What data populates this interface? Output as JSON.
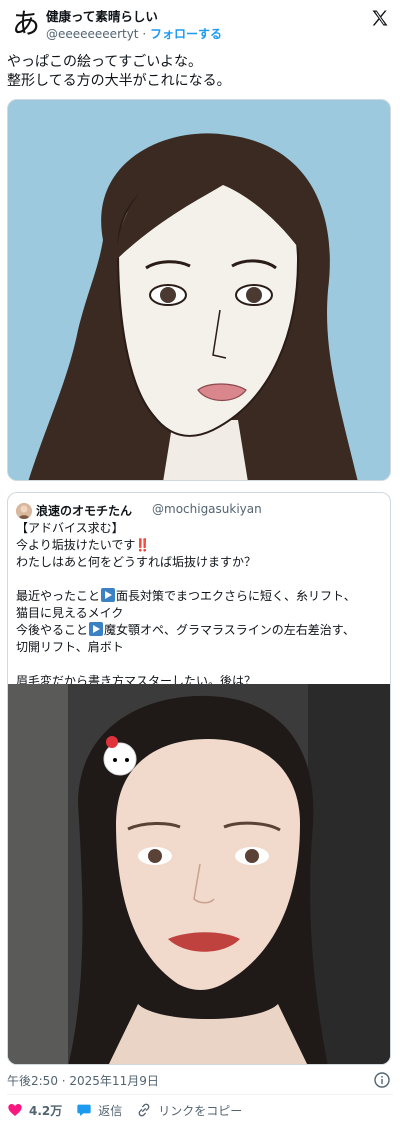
{
  "author": {
    "avatar_char": "あ",
    "name": "健康って素晴らしい",
    "handle": "@eeeeeeeertyt",
    "separator": "·",
    "follow_label": "フォローする"
  },
  "tweet": {
    "lines": [
      "やっぱこの絵ってすごいよな。",
      "整形してる方の大半がこれになる。"
    ]
  },
  "quoted": {
    "name": "浪速のオモチたん",
    "handle": "@mochigasukiyan",
    "line1": "【アドバイス求む】",
    "line2": "今より垢抜けたいです",
    "line2_emoji": "‼️",
    "line3": "わたしはあと何をどうすれば垢抜けますか？",
    "line4_a": "最近やったこと",
    "line4_b": "面長対策でまつエクさらに短く、糸リフト、",
    "line5": "猫目に見えるメイク",
    "line6_a": "今後やること",
    "line6_b": "魔女顎オペ、グラマラスラインの左右差治す、",
    "line7": "切開リフト、肩ボト",
    "line8": "眉毛変だから書き方マスターしたい。後は？"
  },
  "meta": {
    "timestamp": "午後2:50 · 2025年11月9日"
  },
  "actions": {
    "likes": "4.2万",
    "reply": "返信",
    "copy_link": "リンクをコピー"
  },
  "colors": {
    "accent": "#1d9bf0",
    "like": "#f91880",
    "illustration_bg": "#9cc9de"
  }
}
